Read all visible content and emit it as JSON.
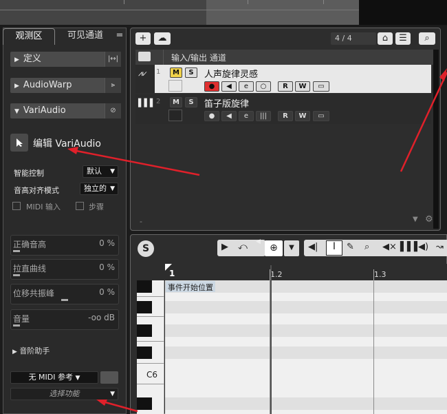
{
  "inspector": {
    "tabs": {
      "inspector": "观测区",
      "visible_channels": "可见通道",
      "menu": "="
    },
    "sections": {
      "define": "定义",
      "audiowarp": "AudioWarp",
      "variaudio": "VariAudio"
    },
    "edit_variaudio": "编辑 VariAudio",
    "smart_control": {
      "label": "智能控制",
      "value": "默认"
    },
    "pitch_align": {
      "label": "音高对齐模式",
      "value": "独立的"
    },
    "midi_input": "MIDI 输入",
    "step": "步骤",
    "sliders": [
      {
        "name": "正确音高",
        "value": "0 %"
      },
      {
        "name": "拉直曲线",
        "value": "0 %"
      },
      {
        "name": "位移共振峰",
        "value": "0 %"
      },
      {
        "name": "音量",
        "value": "-oo dB"
      }
    ],
    "scale_assistant": "音阶助手",
    "midi_ref": "无 MIDI 参考",
    "select_function": "选择功能"
  },
  "tracks": {
    "counter": "4 / 4",
    "header": "输入/输出 通道",
    "list": [
      {
        "number": "1",
        "name": "人声旋律灵感",
        "m": "M",
        "s": "S"
      },
      {
        "number": "2",
        "name": "笛子版旋律",
        "m": "M",
        "s": "S"
      }
    ],
    "footer_dash": "-"
  },
  "editor": {
    "ruler": [
      "1",
      "1.2",
      "1.3"
    ],
    "event_start": "事件开始位置",
    "c6": "C6"
  },
  "colors": {
    "record": "#d0202a",
    "mute_active": "#f0d24a",
    "arrow": "#e0202a"
  }
}
